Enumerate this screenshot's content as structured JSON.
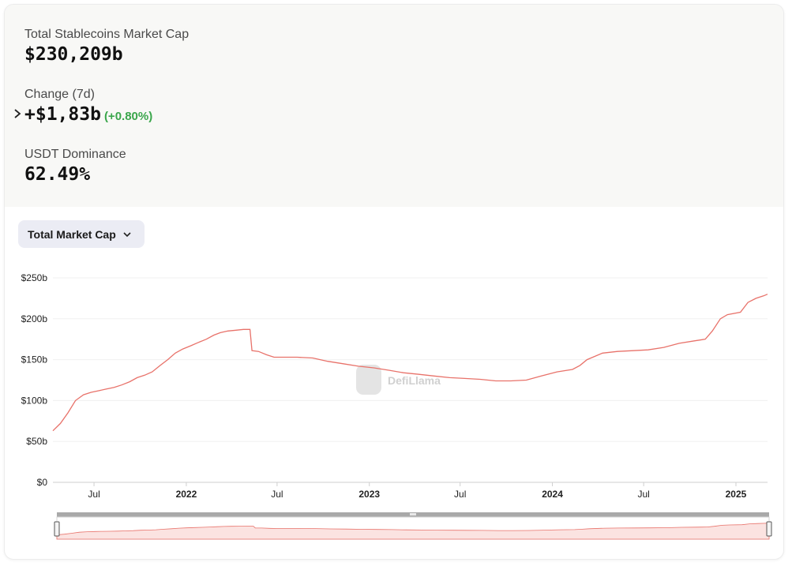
{
  "stats": {
    "total": {
      "label": "Total Stablecoins Market Cap",
      "value": "$230,209b"
    },
    "change": {
      "label": "Change (7d)",
      "value": "+$1,83b",
      "pct": "(+0.80%)"
    },
    "dominance": {
      "label": "USDT Dominance",
      "value": "62.49%"
    }
  },
  "selector": {
    "label": "Total Market Cap",
    "icon": "chevron-down-icon"
  },
  "watermark": {
    "text": "DefiLlama",
    "icon": "llama-logo-icon"
  },
  "colors": {
    "line": "#e8726a",
    "area_fill": "#fbe3e1",
    "positive": "#3aa64b",
    "panel": "#f8f8f6"
  },
  "chart_data": {
    "type": "line",
    "title": "",
    "xlabel": "",
    "ylabel": "",
    "ylim": [
      0,
      250
    ],
    "y_ticks": [
      "$250b",
      "$200b",
      "$150b",
      "$100b",
      "$50b",
      "$0"
    ],
    "y_tick_values": [
      250,
      200,
      150,
      100,
      50,
      0
    ],
    "x_ticks": [
      {
        "label": "Jul",
        "date": "2021-07-01",
        "bold": false
      },
      {
        "label": "2022",
        "date": "2022-01-01",
        "bold": true
      },
      {
        "label": "Jul",
        "date": "2022-07-01",
        "bold": false
      },
      {
        "label": "2023",
        "date": "2023-01-01",
        "bold": true
      },
      {
        "label": "Jul",
        "date": "2023-07-01",
        "bold": false
      },
      {
        "label": "2024",
        "date": "2024-01-01",
        "bold": true
      },
      {
        "label": "Jul",
        "date": "2024-07-01",
        "bold": false
      },
      {
        "label": "2025",
        "date": "2025-01-01",
        "bold": true
      }
    ],
    "x_range": [
      "2021-04-10",
      "2025-03-05"
    ],
    "grid": true,
    "series": [
      {
        "name": "",
        "points": [
          [
            "2021-04-10",
            63
          ],
          [
            "2021-04-25",
            72
          ],
          [
            "2021-05-10",
            85
          ],
          [
            "2021-05-25",
            100
          ],
          [
            "2021-06-10",
            107
          ],
          [
            "2021-06-25",
            110
          ],
          [
            "2021-07-10",
            112
          ],
          [
            "2021-07-25",
            114
          ],
          [
            "2021-08-10",
            116
          ],
          [
            "2021-08-25",
            119
          ],
          [
            "2021-09-10",
            123
          ],
          [
            "2021-09-25",
            128
          ],
          [
            "2021-10-10",
            131
          ],
          [
            "2021-10-25",
            135
          ],
          [
            "2021-11-10",
            143
          ],
          [
            "2021-11-25",
            150
          ],
          [
            "2021-12-10",
            158
          ],
          [
            "2021-12-25",
            163
          ],
          [
            "2022-01-10",
            167
          ],
          [
            "2022-01-25",
            171
          ],
          [
            "2022-02-10",
            175
          ],
          [
            "2022-02-25",
            180
          ],
          [
            "2022-03-10",
            183
          ],
          [
            "2022-03-25",
            185
          ],
          [
            "2022-04-10",
            186
          ],
          [
            "2022-04-25",
            187
          ],
          [
            "2022-05-08",
            187
          ],
          [
            "2022-05-12",
            161
          ],
          [
            "2022-05-25",
            160
          ],
          [
            "2022-06-10",
            156
          ],
          [
            "2022-06-25",
            153
          ],
          [
            "2022-07-15",
            153
          ],
          [
            "2022-08-10",
            153
          ],
          [
            "2022-09-10",
            152
          ],
          [
            "2022-10-10",
            148
          ],
          [
            "2022-11-10",
            145
          ],
          [
            "2022-12-10",
            142
          ],
          [
            "2023-01-10",
            140
          ],
          [
            "2023-02-10",
            137
          ],
          [
            "2023-03-10",
            134
          ],
          [
            "2023-04-10",
            132
          ],
          [
            "2023-05-10",
            130
          ],
          [
            "2023-06-10",
            128
          ],
          [
            "2023-07-10",
            127
          ],
          [
            "2023-08-10",
            126
          ],
          [
            "2023-09-10",
            124
          ],
          [
            "2023-10-10",
            124
          ],
          [
            "2023-11-10",
            125
          ],
          [
            "2023-12-10",
            130
          ],
          [
            "2024-01-10",
            135
          ],
          [
            "2024-02-10",
            138
          ],
          [
            "2024-02-25",
            143
          ],
          [
            "2024-03-10",
            150
          ],
          [
            "2024-04-10",
            158
          ],
          [
            "2024-05-10",
            160
          ],
          [
            "2024-06-10",
            161
          ],
          [
            "2024-07-10",
            162
          ],
          [
            "2024-08-10",
            165
          ],
          [
            "2024-09-10",
            170
          ],
          [
            "2024-10-10",
            173
          ],
          [
            "2024-11-01",
            175
          ],
          [
            "2024-11-15",
            185
          ],
          [
            "2024-12-01",
            200
          ],
          [
            "2024-12-15",
            205
          ],
          [
            "2025-01-10",
            208
          ],
          [
            "2025-01-25",
            220
          ],
          [
            "2025-02-10",
            225
          ],
          [
            "2025-02-25",
            228
          ],
          [
            "2025-03-05",
            230
          ]
        ]
      }
    ]
  }
}
